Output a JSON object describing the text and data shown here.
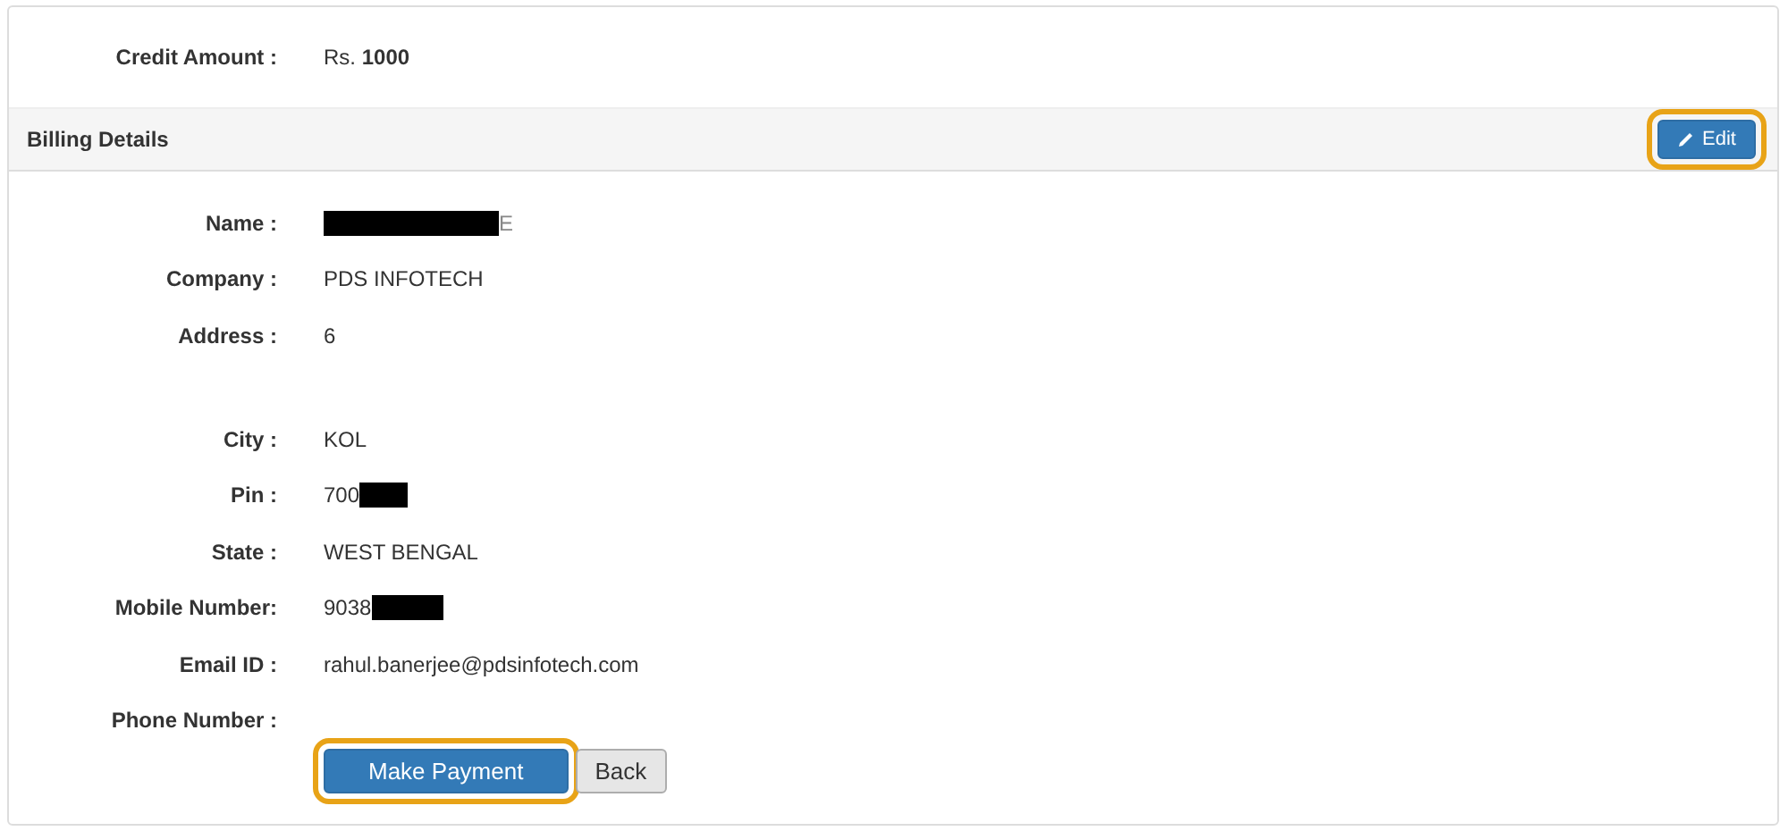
{
  "credit": {
    "label": "Credit Amount :",
    "prefix": "Rs.",
    "amount": "1000"
  },
  "billing": {
    "title": "Billing Details",
    "edit_button": {
      "label": "Edit",
      "highlighted": true
    },
    "fields": [
      {
        "label": "Name :",
        "redacted": true,
        "value_after": "E"
      },
      {
        "label": "Company :",
        "value": "PDS INFOTECH"
      },
      {
        "label": "Address :",
        "value": "6",
        "tall": true
      },
      {
        "label": "City :",
        "value": "KOL"
      },
      {
        "label": "Pin :",
        "value": "700",
        "redacted": true
      },
      {
        "label": "State :",
        "value": "WEST BENGAL"
      },
      {
        "label": "Mobile Number:",
        "value": "9038",
        "redacted": true
      },
      {
        "label": "Email ID :",
        "value": "rahul.banerjee@pdsinfotech.com"
      },
      {
        "label": "Phone Number :"
      }
    ]
  },
  "buttons": [
    {
      "label": "Make Payment",
      "kind": "primary",
      "highlighted": true
    },
    {
      "label": "Back",
      "kind": "default",
      "highlighted": false
    }
  ]
}
